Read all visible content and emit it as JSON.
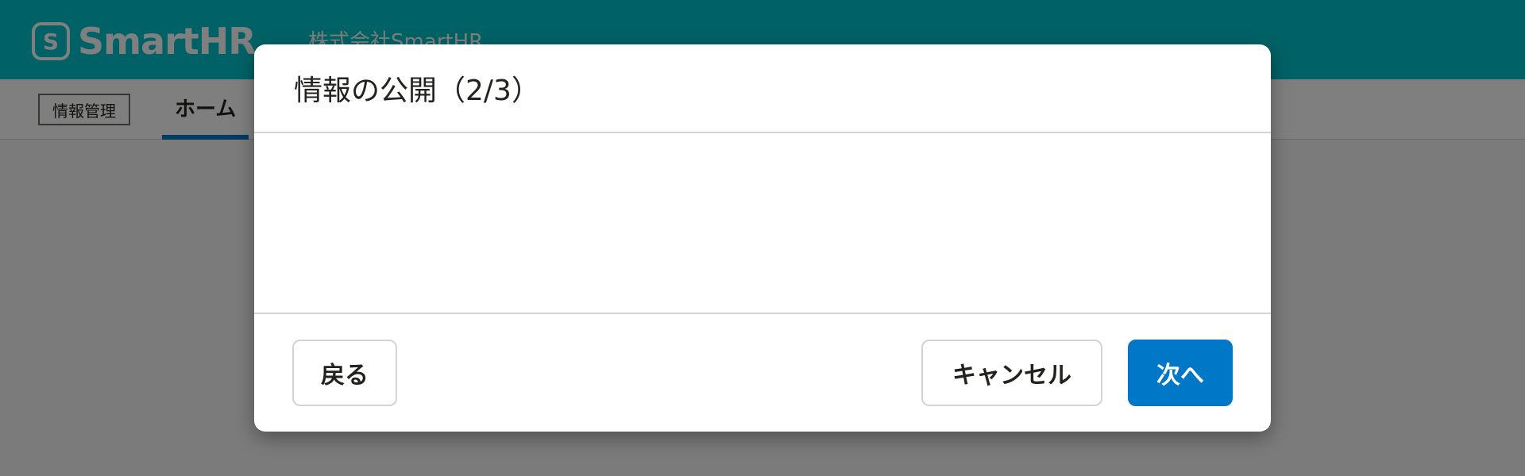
{
  "header": {
    "logo_text": "SmartHR",
    "logo_mark": "S",
    "company_name": "株式会社SmartHR"
  },
  "subnav": {
    "app_badge": "情報管理",
    "active_tab": "ホーム"
  },
  "dialog": {
    "title": "情報の公開（2/3）",
    "back_label": "戻る",
    "cancel_label": "キャンセル",
    "next_label": "次へ"
  },
  "colors": {
    "brand": "#00c4cc",
    "primary": "#0077c7",
    "overlay": "rgba(0,0,0,0.5)"
  }
}
